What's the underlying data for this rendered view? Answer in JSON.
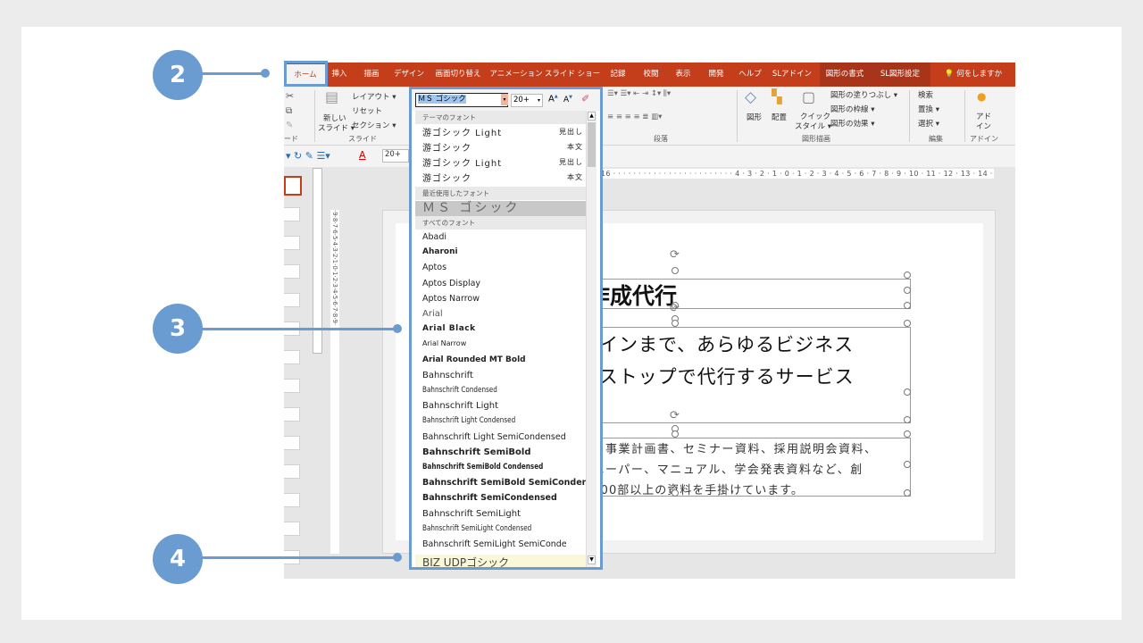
{
  "tabs": [
    "ホーム",
    "挿入",
    "描画",
    "デザイン",
    "画面切り替え",
    "アニメーション",
    "スライド ショー",
    "記録",
    "校閲",
    "表示",
    "開発",
    "ヘルプ",
    "SLアドイン",
    "図形の書式",
    "SL図形設定",
    "何をしますか"
  ],
  "ribbon": {
    "clip_label": "ード",
    "new_slide": "新しい",
    "new_slide2": "スライド ▾",
    "layout": "レイアウト ▾",
    "reset": "リセット",
    "section": "セクション ▾",
    "slide_group": "スライド",
    "para_group": "段落",
    "shape": "図形",
    "arrange": "配置",
    "quick": "クイック",
    "quick2": "スタイル ▾",
    "fill": "図形の塗りつぶし ▾",
    "outline": "図形の枠線 ▾",
    "effect": "図形の効果 ▾",
    "draw_group": "図形描画",
    "find": "検索",
    "replace": "置換 ▾",
    "select": "選択 ▾",
    "edit_group": "編集",
    "addin": "アド",
    "addin2": "イン",
    "addin_group": "アドイン"
  },
  "mini": {
    "size": "20+"
  },
  "ruler": "16 · · · · · · · · · · · · · · · · · · · · · · · · 4 · 3 · 2 · 1 · 0 · 1 · 2 · 3 · 4 · 5 · 6 · 7 · 8 · 9 · 10 · 11 · 12 · 13 · 14 · 15 · 16",
  "vruler": "·9·8·7·6·5·4·3·2·1·0·1·2·3·4·5·6·7·8·9·",
  "slide": {
    "title": "作成代行",
    "sub1": "ザインまで、あらゆるビジネス",
    "sub2": "ンストップで代行するサービス",
    "body1": "書、事業計画書、セミナー資料、採用説明会資料、",
    "body2": "トペーパー、マニュアル、学会発表資料など、創",
    "body3": "2,200部以上の資料を手掛けています。"
  },
  "font_dropdown": {
    "current_font": "ＭＳ ゴシック",
    "size": "20+",
    "theme_header": "テーマのフォント",
    "theme_fonts": [
      {
        "name": "游ゴシック Light",
        "tag": "見出し"
      },
      {
        "name": "游ゴシック",
        "tag": "本文"
      },
      {
        "name": "游ゴシック Light",
        "tag": "見出し"
      },
      {
        "name": "游ゴシック",
        "tag": "本文"
      }
    ],
    "recent_header": "最近使用したフォント",
    "recent_fonts": [
      "ＭＳ ゴシック"
    ],
    "all_header": "すべてのフォント",
    "all_fonts": [
      "Abadi",
      "Aharoni",
      "Aptos",
      "Aptos Display",
      "Aptos Narrow",
      "Arial",
      "Arial Black",
      "Arial Narrow",
      "Arial Rounded MT Bold",
      "Bahnschrift",
      "Bahnschrift Condensed",
      "Bahnschrift Light",
      "Bahnschrift Light Condensed",
      "Bahnschrift Light SemiCondensed",
      "Bahnschrift SemiBold",
      "Bahnschrift SemiBold Condensed",
      "Bahnschrift SemiBold SemiConden",
      "Bahnschrift SemiCondensed",
      "Bahnschrift SemiLight",
      "Bahnschrift SemiLight Condensed",
      "Bahnschrift SemiLight SemiConde",
      "BIZ UDPゴシック"
    ]
  },
  "callouts": [
    "2",
    "3",
    "4"
  ],
  "colors": {
    "accent": "#6a9bd1",
    "ribbon": "#c43e1c"
  }
}
